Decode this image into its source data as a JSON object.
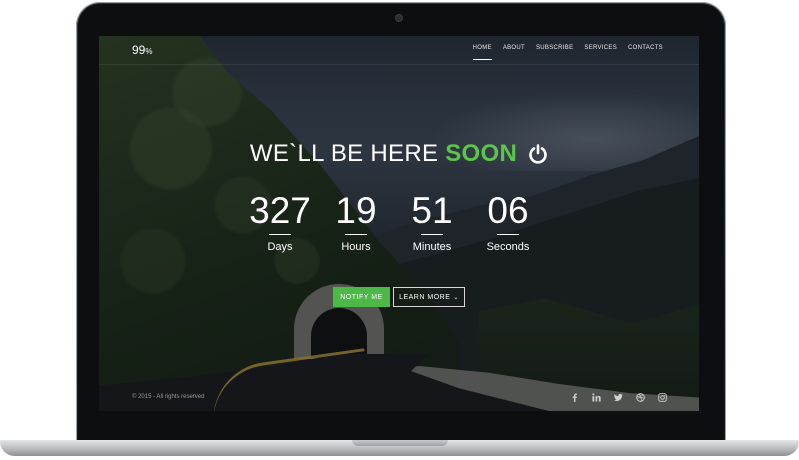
{
  "brand": {
    "logo_number": "99",
    "logo_suffix": "%"
  },
  "nav": {
    "items": [
      {
        "label": "HOME",
        "active": true
      },
      {
        "label": "ABOUT"
      },
      {
        "label": "SUBSCRIBE"
      },
      {
        "label": "SERVICES"
      },
      {
        "label": "CONTACTS"
      }
    ]
  },
  "hero": {
    "headline_light": "WE`LL BE HERE",
    "headline_accent": "SOON",
    "accent_color": "#5cc64a",
    "icon": "power-icon"
  },
  "countdown": {
    "days": {
      "value": "327",
      "label": "Days"
    },
    "hours": {
      "value": "19",
      "label": "Hours"
    },
    "minutes": {
      "value": "51",
      "label": "Minutes"
    },
    "seconds": {
      "value": "06",
      "label": "Seconds"
    }
  },
  "actions": {
    "notify_label": "NOTIFY ME",
    "learn_more_label": "LEARN MORE",
    "notify_color": "#4cb848"
  },
  "footer": {
    "copyright": "© 2015 - All rights reserved",
    "social_icons": [
      "facebook-icon",
      "linkedin-icon",
      "twitter-icon",
      "dribbble-icon",
      "instagram-icon"
    ]
  }
}
